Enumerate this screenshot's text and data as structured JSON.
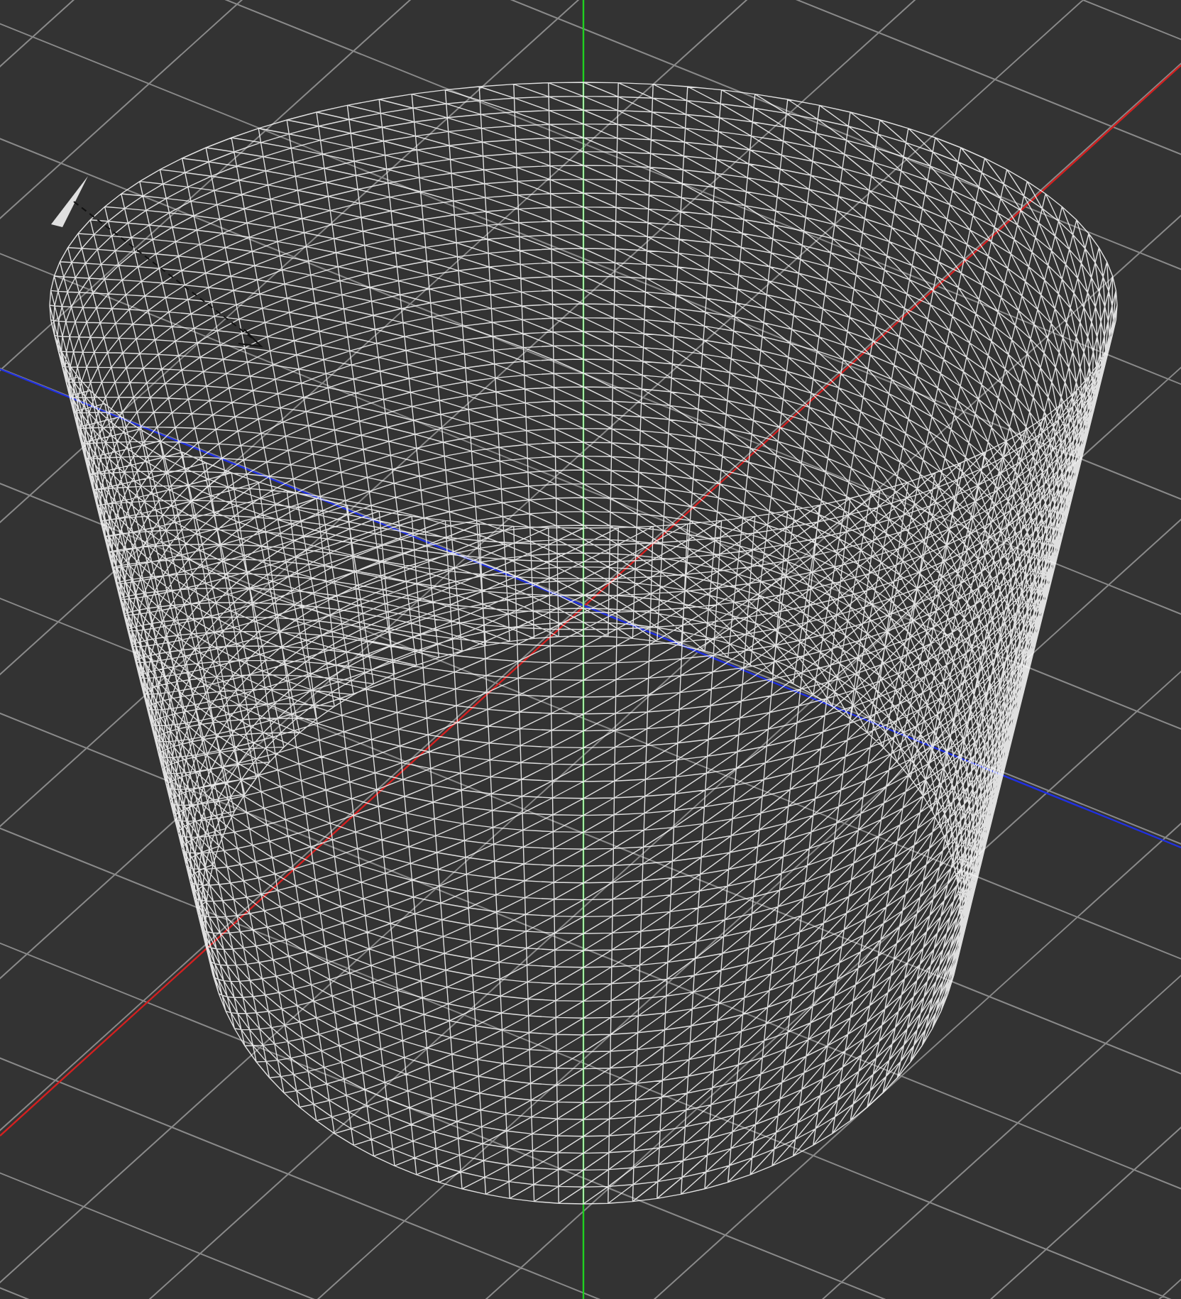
{
  "viewport": {
    "show_grid": true,
    "show_axes": true,
    "show_light": true,
    "object": {
      "kind": "cylinder",
      "wireframe": true
    }
  }
}
